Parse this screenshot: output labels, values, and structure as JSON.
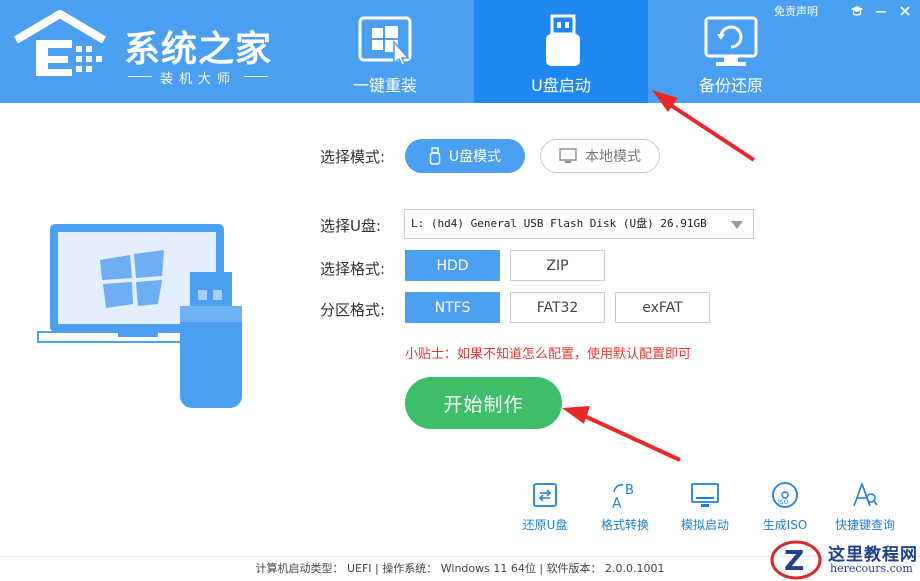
{
  "app": {
    "logo_title": "系统之家",
    "logo_subtitle": "装机大师",
    "disclaimer": "免责声明"
  },
  "tabs": [
    {
      "label": "一键重装",
      "icon": "windows-cursor-icon",
      "active": false
    },
    {
      "label": "U盘启动",
      "icon": "usb-drive-icon",
      "active": true
    },
    {
      "label": "备份还原",
      "icon": "restore-monitor-icon",
      "active": false
    }
  ],
  "mode": {
    "label": "选择模式:",
    "options": [
      {
        "label": "U盘模式",
        "icon": "usb-icon",
        "selected": true
      },
      {
        "label": "本地模式",
        "icon": "monitor-icon",
        "selected": false
      }
    ]
  },
  "usb_select": {
    "label": "选择U盘:",
    "value": "L: (hd4) General USB Flash Disk  (U盘) 26.91GB"
  },
  "format": {
    "label": "选择格式:",
    "options": [
      "HDD",
      "ZIP"
    ],
    "selected": "HDD"
  },
  "partition": {
    "label": "分区格式:",
    "options": [
      "NTFS",
      "FAT32",
      "exFAT"
    ],
    "selected": "NTFS"
  },
  "tip": "小贴士：如果不知道怎么配置，使用默认配置即可",
  "start_button": "开始制作",
  "tools": [
    {
      "label": "还原U盘",
      "icon": "restore-usb-icon"
    },
    {
      "label": "格式转换",
      "icon": "format-convert-icon"
    },
    {
      "label": "模拟启动",
      "icon": "simulate-boot-icon"
    },
    {
      "label": "生成ISO",
      "icon": "iso-disc-icon"
    },
    {
      "label": "快捷键查询",
      "icon": "hotkey-search-icon"
    }
  ],
  "statusbar": "计算机启动类型： UEFI | 操作系统： Windows 11 64位 | 软件版本： 2.0.0.1001",
  "watermark": {
    "title": "这里教程网",
    "url": "herecours.com"
  },
  "colors": {
    "header": "#4a9ff0",
    "active_tab": "#1e88f0",
    "start_button": "#3fbe6a",
    "tip": "#e53935",
    "annotation_arrow": "#e8282b"
  }
}
